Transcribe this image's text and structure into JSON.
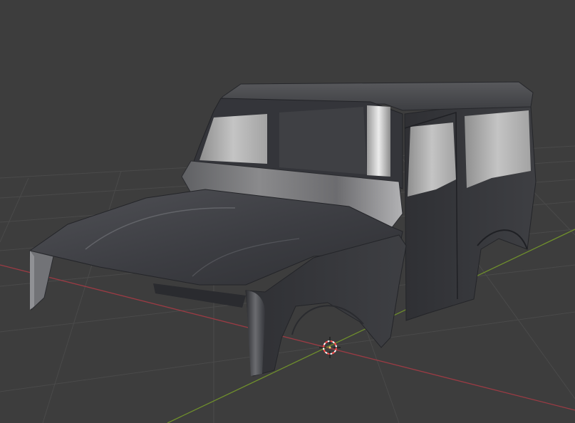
{
  "viewport": {
    "background_color": "#3d3d3d",
    "grid_color": "#4a4a4a",
    "x_axis_color": "#9b3b44",
    "y_axis_color": "#6f8f2c",
    "cursor_icon": "3d-cursor-icon"
  },
  "model": {
    "body_color": "#3a3b3f",
    "window_color": "#b9b9b9"
  }
}
